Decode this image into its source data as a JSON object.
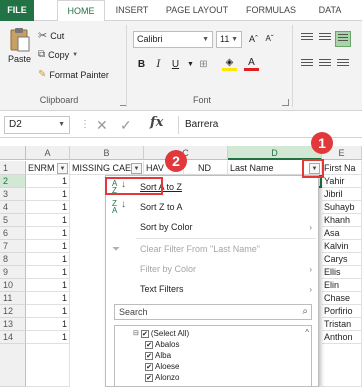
{
  "ribbon_tabs": [
    {
      "label": "FILE"
    },
    {
      "label": "HOME"
    },
    {
      "label": "INSERT"
    },
    {
      "label": "PAGE LAYOUT"
    },
    {
      "label": "FORMULAS"
    },
    {
      "label": "DATA"
    }
  ],
  "clipboard": {
    "paste_label": "Paste",
    "cut_label": "Cut",
    "copy_label": "Copy",
    "format_painter_label": "Format Painter",
    "group_label": "Clipboard"
  },
  "font": {
    "font_name": "Calibri",
    "font_size": "11",
    "bold": "B",
    "italic": "I",
    "underline": "U",
    "grow": "Aˆ",
    "shrink": "Aˇ",
    "group_label": "Font"
  },
  "formula_bar": {
    "name_box": "D2",
    "fx": "fx",
    "value": "Barrera"
  },
  "columns": [
    "A",
    "B",
    "C",
    "D",
    "E"
  ],
  "selected_column": "D",
  "header_row": {
    "row_number": "1",
    "cells": [
      "ENRM",
      "MISSING CAE",
      "HAV",
      "ND",
      "Last Name",
      "First Na"
    ]
  },
  "rows": [
    {
      "n": "2",
      "a": "1",
      "e": "Yahir"
    },
    {
      "n": "3",
      "a": "1",
      "e": "Jibril"
    },
    {
      "n": "4",
      "a": "1",
      "e": "Suhayb"
    },
    {
      "n": "5",
      "a": "1",
      "e": "Khanh"
    },
    {
      "n": "6",
      "a": "1",
      "e": "Asa"
    },
    {
      "n": "7",
      "a": "1",
      "e": "Kalvin"
    },
    {
      "n": "8",
      "a": "1",
      "e": "Carys"
    },
    {
      "n": "9",
      "a": "1",
      "e": "Ellis"
    },
    {
      "n": "10",
      "a": "1",
      "e": "Elin"
    },
    {
      "n": "11",
      "a": "1",
      "e": "Chase"
    },
    {
      "n": "12",
      "a": "1",
      "e": "Porfirio"
    },
    {
      "n": "13",
      "a": "1",
      "e": "Tristan"
    },
    {
      "n": "14",
      "a": "1",
      "e": "Anthon"
    }
  ],
  "filter_menu": {
    "sort_az": "Sort A to Z",
    "sort_za": "Sort Z to A",
    "sort_by_color": "Sort by Color",
    "clear_filter": "Clear Filter From \"Last Name\"",
    "filter_by_color": "Filter by Color",
    "text_filters": "Text Filters",
    "search_placeholder": "Search",
    "items": [
      "(Select All)",
      "Abalos",
      "Alba",
      "Aloese",
      "Alonzo"
    ]
  },
  "callouts": {
    "one": "1",
    "two": "2"
  },
  "colors": {
    "excel_green": "#217346",
    "callout_red": "#e0383b"
  }
}
